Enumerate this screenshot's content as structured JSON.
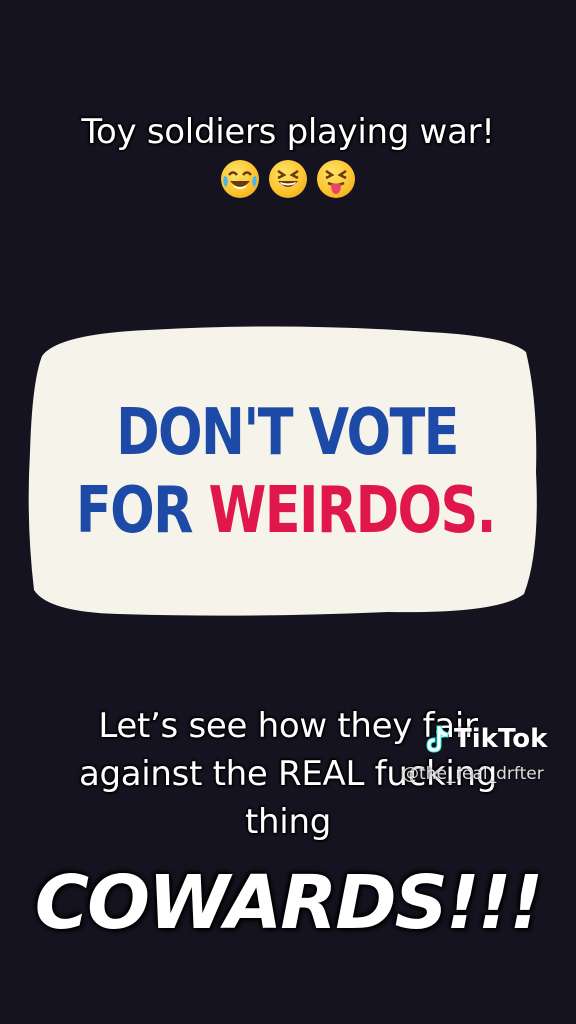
{
  "top_caption": {
    "line1": "Toy soldiers playing war!",
    "emojis": [
      "face-with-tears-of-joy",
      "grinning-squinting-face",
      "squinting-face-with-tongue"
    ]
  },
  "sign": {
    "line1": "DON'T VOTE",
    "line2_part1": "FOR ",
    "line2_part2": "WEIRDOS.",
    "colors": {
      "blue": "#1d4aa6",
      "red": "#e0174a",
      "background": "#f6f3ea"
    }
  },
  "bottom_caption": {
    "line1": "Let’s see how they fair",
    "line2": "against the REAL fucking",
    "line3": "thing"
  },
  "headline": "COWARDS!!!",
  "watermark": {
    "brand": "TikTok",
    "handle": "@the_real_drfter"
  }
}
